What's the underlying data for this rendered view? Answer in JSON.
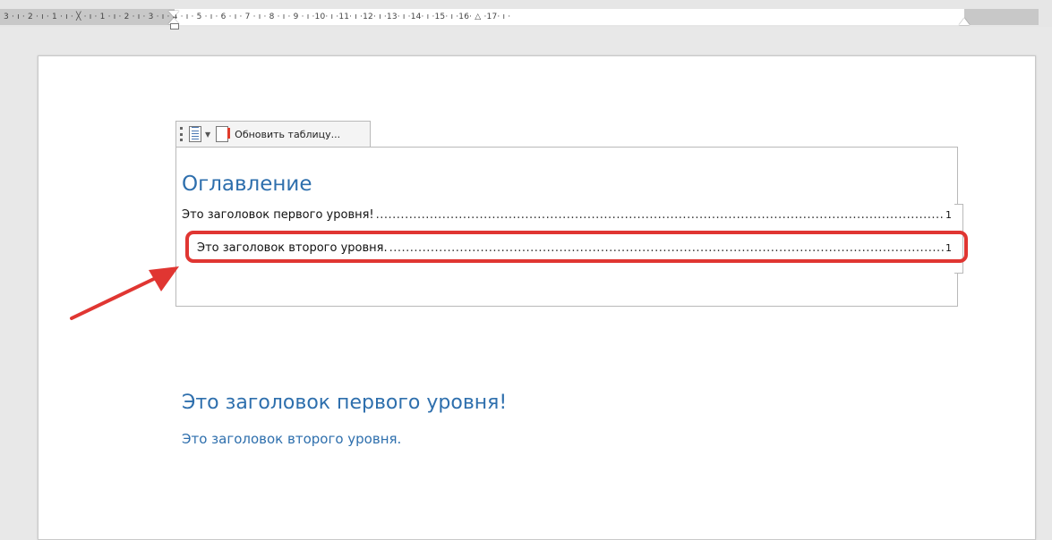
{
  "ruler": {
    "ticks": "3 · ı · 2 · ı · 1 · ı · ╳ · ı · 1 · ı · 2 · ı · 3 · ı · 4 · ı · 5 · ı · 6 · ı · 7 · ı · 8 · ı · 9 · ı ·10· ı ·11· ı ·12· ı ·13· ı ·14· ı ·15· ı ·16· △ ·17· ı ·"
  },
  "toc_toolbar": {
    "update_label": "Обновить таблицу..."
  },
  "toc": {
    "title": "Оглавление",
    "entries": [
      {
        "text": "Это заголовок первого уровня!",
        "page": "1"
      },
      {
        "text": "Это заголовок второго уровня.",
        "page": "1"
      }
    ]
  },
  "document": {
    "heading1": "Это заголовок первого уровня!",
    "heading2": "Это заголовок второго уровня."
  },
  "colors": {
    "heading": "#2e6fad",
    "highlight": "#e03632"
  }
}
